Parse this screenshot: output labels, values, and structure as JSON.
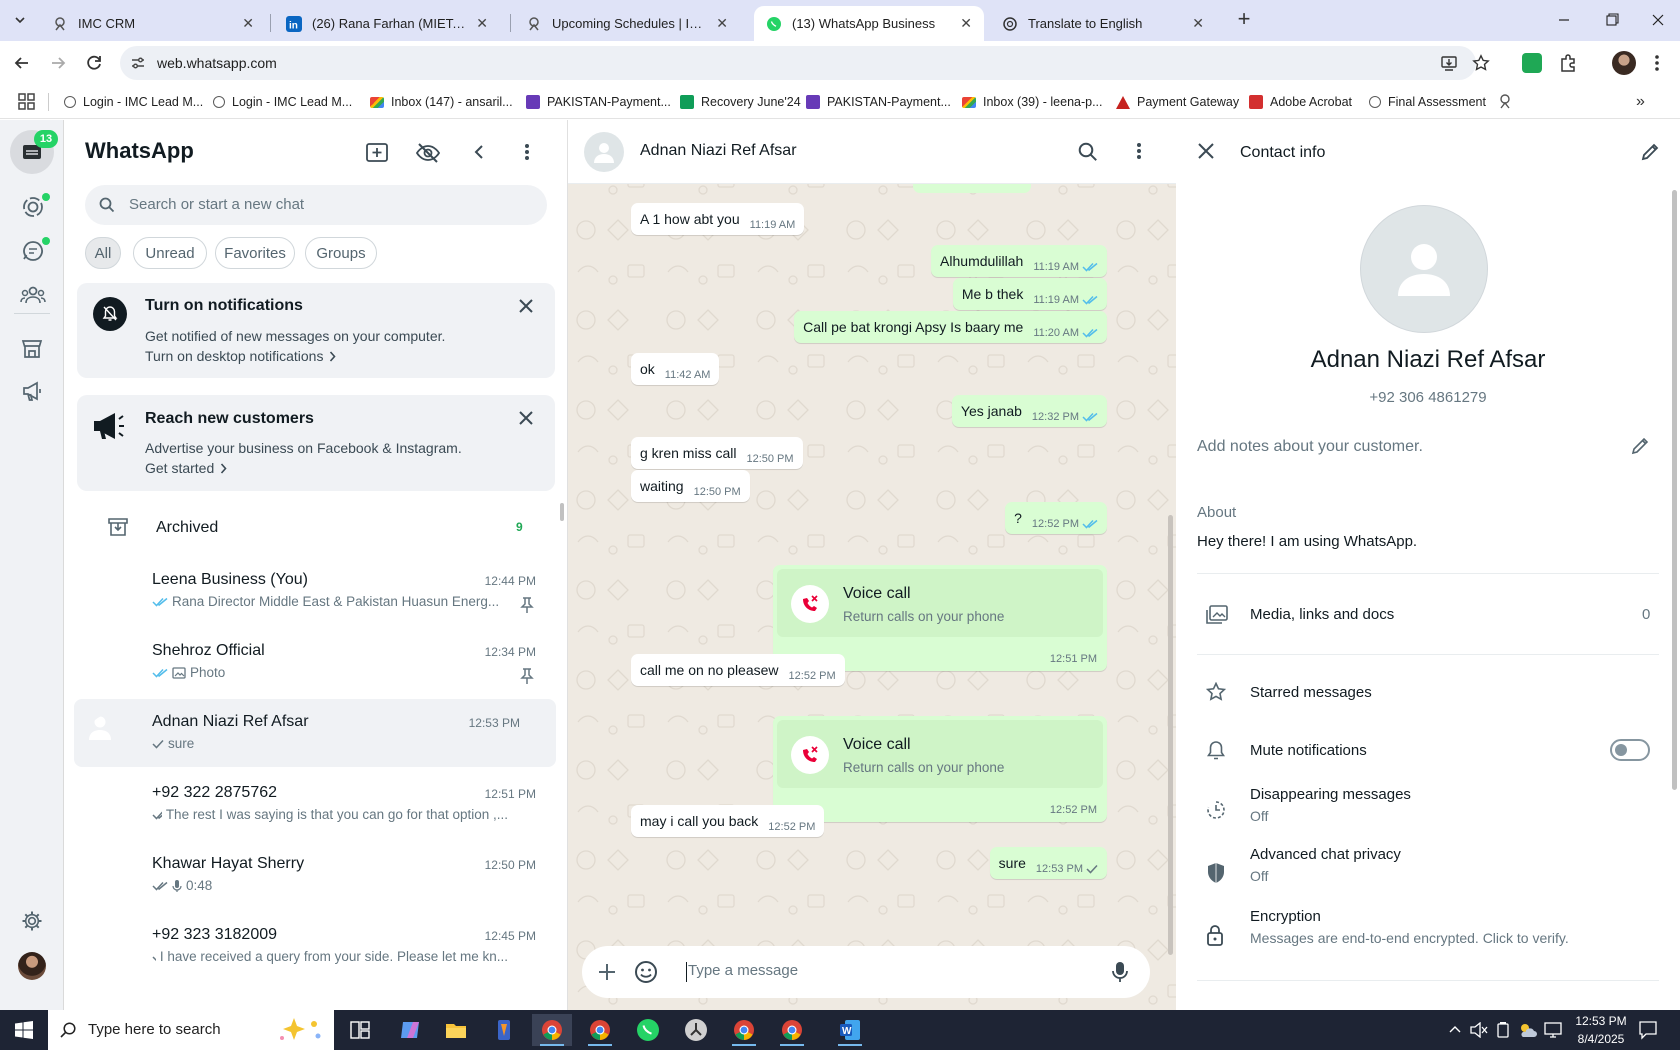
{
  "browser": {
    "tabs": [
      {
        "title": "IMC CRM",
        "active": false
      },
      {
        "title": "(26) Rana Farhan (MIET, MS Eng",
        "active": false
      },
      {
        "title": "Upcoming Schedules | IMC Cert",
        "active": false
      },
      {
        "title": "(13) WhatsApp Business",
        "active": true
      },
      {
        "title": "Translate to English",
        "active": false
      }
    ],
    "url": "web.whatsapp.com",
    "bookmarks": [
      {
        "label": "Login - IMC Lead M...",
        "icon": "crm",
        "color": "#5b5b5b"
      },
      {
        "label": "Login - IMC Lead M...",
        "icon": "crm",
        "color": "#5b5b5b"
      },
      {
        "label": "Inbox (147) - ansaril...",
        "icon": "gmail",
        "color": "#d93025"
      },
      {
        "label": "PAKISTAN-Payment...",
        "icon": "sheet",
        "color": "#673ab7"
      },
      {
        "label": "Recovery June'24",
        "icon": "sheet",
        "color": "#0f9d58"
      },
      {
        "label": "PAKISTAN-Payment...",
        "icon": "sheet",
        "color": "#673ab7"
      },
      {
        "label": "Inbox (39) - leena-p...",
        "icon": "gmail",
        "color": "#d93025"
      },
      {
        "label": "Payment Gateway",
        "icon": "triangle",
        "color": "#c5221f"
      },
      {
        "label": "Adobe Acrobat",
        "icon": "acrobat",
        "color": "#d32f2f"
      },
      {
        "label": "Final Assessment",
        "icon": "crm",
        "color": "#5b5b5b"
      }
    ]
  },
  "rail": {
    "badge": "13"
  },
  "sidebar": {
    "title": "WhatsApp",
    "search_placeholder": "Search or start a new chat",
    "filters": [
      "All",
      "Unread",
      "Favorites",
      "Groups"
    ],
    "notif_card": {
      "title": "Turn on notifications",
      "body": "Get notified of new messages on your computer.",
      "link": "Turn on desktop notifications"
    },
    "reach_card": {
      "title": "Reach new customers",
      "body": "Advertise your business on Facebook & Instagram.",
      "link": "Get started"
    },
    "archived": {
      "label": "Archived",
      "count": "9"
    },
    "chats": [
      {
        "name": "Leena Business (You)",
        "time": "12:44 PM",
        "preview": "Rana Director Middle East & Pakistan Huasun Energ...",
        "ticks": "double-blue",
        "pinned": true,
        "avatar": "photo-woman"
      },
      {
        "name": "Shehroz Official",
        "time": "12:34 PM",
        "preview": "Photo",
        "ticks": "double-blue",
        "pinned": true,
        "avatar": "photo-red",
        "media": "photo-icon"
      },
      {
        "name": "Adnan Niazi Ref Afsar",
        "time": "12:53 PM",
        "preview": "sure",
        "ticks": "single",
        "pinned": false,
        "avatar": "default",
        "selected": true
      },
      {
        "name": "+92 322 2875762",
        "time": "12:51 PM",
        "preview": "The rest I was saying is that you can go for that option ,...",
        "ticks": "double",
        "pinned": false,
        "avatar": "default"
      },
      {
        "name": "Khawar Hayat Sherry",
        "time": "12:50 PM",
        "preview": "0:48",
        "ticks": "double",
        "pinned": false,
        "avatar": "default",
        "media": "mic-icon"
      },
      {
        "name": "+92 323 3182009",
        "time": "12:45 PM",
        "preview": "I have received a query from your side. Please let me kn...",
        "ticks": "double",
        "pinned": false,
        "avatar": "photo-man"
      }
    ]
  },
  "chat": {
    "contact": "Adnan Niazi Ref Afsar",
    "input_placeholder": "Type a message",
    "messages": [
      {
        "dir": "in",
        "text": "A 1 how abt you",
        "time": "11:19 AM"
      },
      {
        "dir": "out",
        "text": "Alhumdulillah",
        "time": "11:19 AM",
        "ticks": "double-blue"
      },
      {
        "dir": "out",
        "text": "Me b thek",
        "time": "11:19 AM",
        "ticks": "double-blue"
      },
      {
        "dir": "out",
        "text": "Call pe bat krongi Apsy Is baary me",
        "time": "11:20 AM",
        "ticks": "double-blue"
      },
      {
        "dir": "in",
        "text": "ok",
        "time": "11:42 AM"
      },
      {
        "dir": "out",
        "text": "Yes janab",
        "time": "12:32 PM",
        "ticks": "double-blue"
      },
      {
        "dir": "in",
        "text": "g kren miss call",
        "time": "12:50 PM"
      },
      {
        "dir": "in",
        "text": "waiting",
        "time": "12:50 PM"
      },
      {
        "dir": "out",
        "text": "?",
        "time": "12:52 PM",
        "ticks": "double-blue"
      },
      {
        "dir": "out",
        "type": "call",
        "title": "Voice call",
        "sub": "Return calls on your phone",
        "time": "12:51 PM"
      },
      {
        "dir": "in",
        "text": "call me on no pleasew",
        "time": "12:52 PM"
      },
      {
        "dir": "out",
        "type": "call",
        "title": "Voice call",
        "sub": "Return calls on your phone",
        "time": "12:52 PM"
      },
      {
        "dir": "in",
        "text": "may i call you back",
        "time": "12:52 PM"
      },
      {
        "dir": "out",
        "text": "sure",
        "time": "12:53 PM",
        "ticks": "single"
      }
    ]
  },
  "contact_info": {
    "header": "Contact info",
    "name": "Adnan Niazi Ref Afsar",
    "phone": "+92 306 4861279",
    "notes_placeholder": "Add notes about your customer.",
    "about_label": "About",
    "about_text": "Hey there! I am using WhatsApp.",
    "media_label": "Media, links and docs",
    "media_count": "0",
    "starred": "Starred messages",
    "mute": "Mute notifications",
    "mute_on": false,
    "disappearing": {
      "label": "Disappearing messages",
      "value": "Off"
    },
    "privacy": {
      "label": "Advanced chat privacy",
      "value": "Off"
    },
    "encryption": {
      "label": "Encryption",
      "value": "Messages are end-to-end encrypted. Click to verify."
    }
  },
  "taskbar": {
    "search_placeholder": "Type here to search",
    "time": "12:53 PM",
    "date": "8/4/2025"
  },
  "colors": {
    "accent": "#00a884",
    "outgoing": "#d9fdd3",
    "chat_bg": "#efeae2",
    "tick_blue": "#53bdeb",
    "missed_call": "#ea0038"
  }
}
